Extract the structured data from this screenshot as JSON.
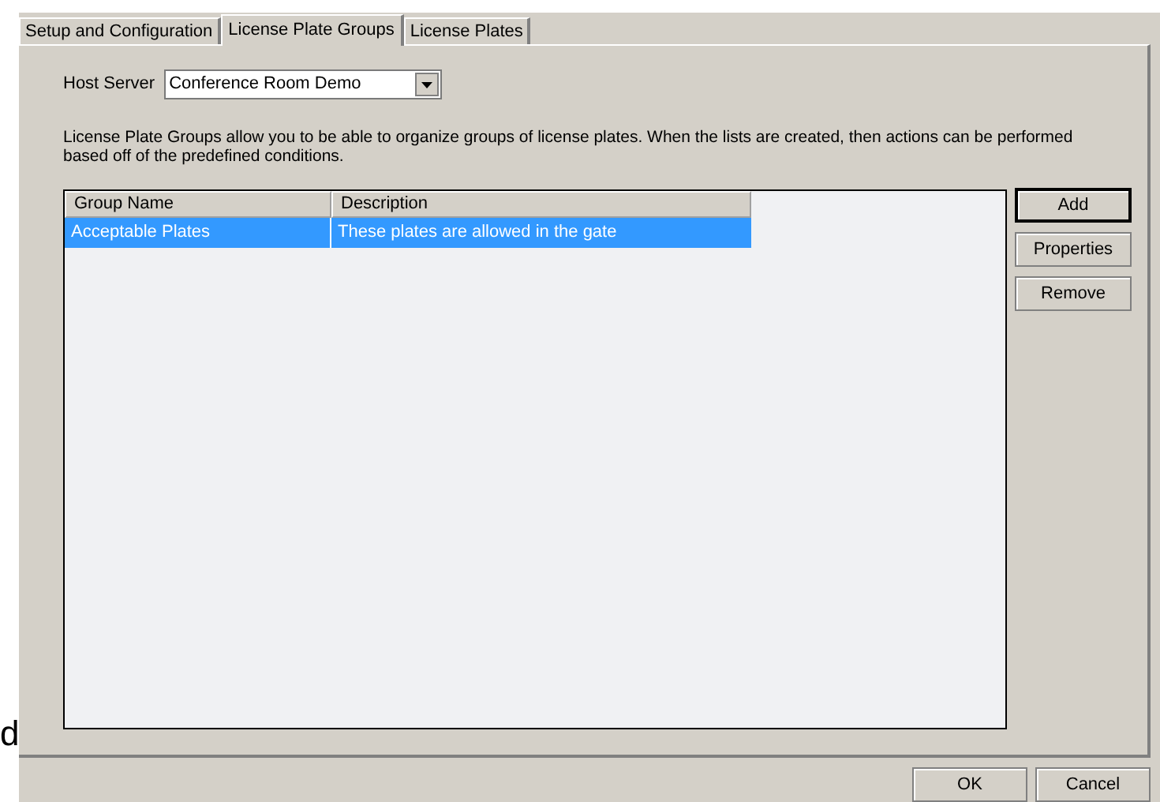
{
  "background_text": "d",
  "tabs": [
    {
      "label": "Setup and Configuration",
      "selected": false
    },
    {
      "label": "License Plate Groups",
      "selected": true
    },
    {
      "label": "License Plates",
      "selected": false
    }
  ],
  "host_server": {
    "label": "Host Server",
    "value": "Conference Room Demo"
  },
  "description": "License Plate Groups allow you to be able to organize groups of license plates.  When the lists are created, then actions can be performed based off of the predefined conditions.",
  "table": {
    "columns": [
      "Group Name",
      "Description"
    ],
    "rows": [
      {
        "cells": [
          "Acceptable Plates",
          "These plates are allowed in the gate"
        ],
        "selected": true
      }
    ]
  },
  "side_buttons": [
    {
      "label": "Add",
      "default": true
    },
    {
      "label": "Properties",
      "default": false
    },
    {
      "label": "Remove",
      "default": false
    }
  ],
  "footer_buttons": [
    "OK",
    "Cancel"
  ]
}
